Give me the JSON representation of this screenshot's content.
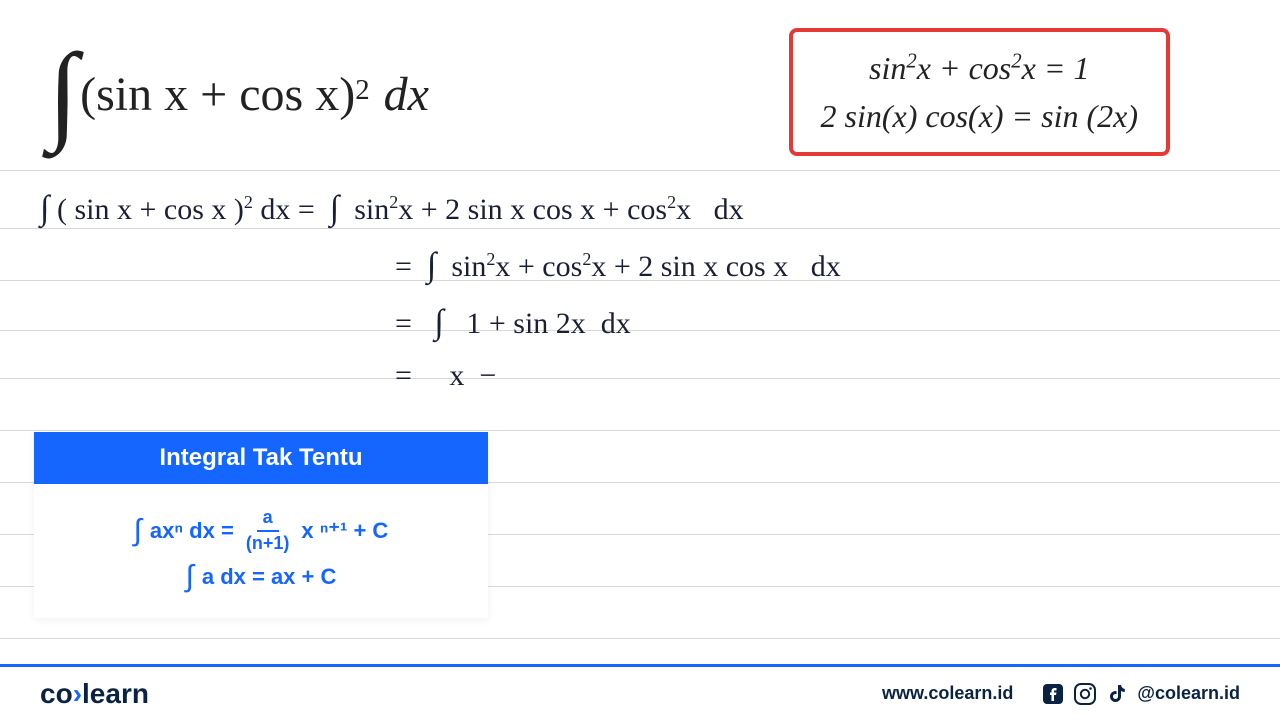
{
  "problem": {
    "integrand_open": "(sin x + cos x)",
    "exponent": "2",
    "dx": "dx"
  },
  "identities": {
    "line1": "sin²x + cos²x = 1",
    "line2": "2 sin(x) cos(x) = sin (2x)"
  },
  "handwriting": {
    "l1_left": "∫ ( sin x + cos x )² dx = ",
    "l1_right": "∫  sin²x + 2 sin x cos x + cos²x   dx",
    "l2": "=  ∫  sin²x + cos²x + 2 sin x cos x   dx",
    "l3": "=   ∫   1 + sin 2x  dx",
    "l4": "=     x  −"
  },
  "info_card": {
    "title": "Integral Tak Tentu",
    "formula1_lhs": "axⁿ dx =",
    "formula1_frac_top": "a",
    "formula1_frac_bot": "(n+1)",
    "formula1_rhs": "x ⁿ⁺¹ + C",
    "formula2": "a dx =  ax + C"
  },
  "footer": {
    "logo_part1": "co",
    "logo_sep": "›",
    "logo_part2": "learn",
    "url": "www.colearn.id",
    "handle": "@colearn.id"
  }
}
